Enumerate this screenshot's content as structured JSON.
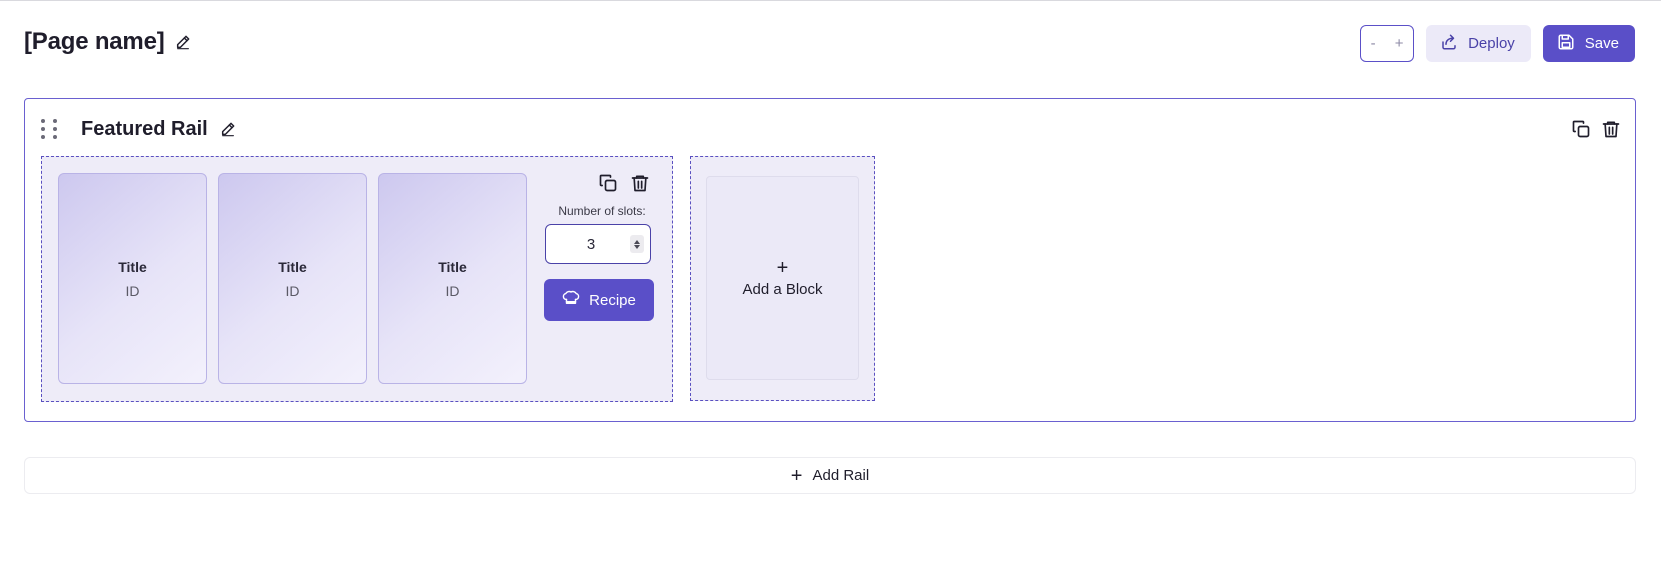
{
  "header": {
    "page_title": "[Page name]",
    "zoom_out_label": "-",
    "zoom_in_label": "+",
    "deploy_label": "Deploy",
    "save_label": "Save"
  },
  "rail": {
    "title": "Featured Rail",
    "block": {
      "slots": [
        {
          "title": "Title",
          "id": "ID"
        },
        {
          "title": "Title",
          "id": "ID"
        },
        {
          "title": "Title",
          "id": "ID"
        }
      ],
      "slots_label": "Number of slots:",
      "slots_value": "3",
      "recipe_label": "Recipe"
    },
    "add_block_label": "Add a Block",
    "add_block_plus": "+"
  },
  "add_rail": {
    "plus": "+",
    "label": "Add Rail"
  },
  "icons": {
    "edit": "pencil-icon",
    "duplicate": "copy-icon",
    "delete": "trash-icon",
    "deploy": "share-icon",
    "save": "floppy-disk-icon",
    "recipe": "chef-hat-icon",
    "drag": "drag-handle-icon"
  },
  "colors": {
    "accent": "#5a4fc8",
    "accent_light": "#eeecf8",
    "text": "#1f1d2b"
  }
}
